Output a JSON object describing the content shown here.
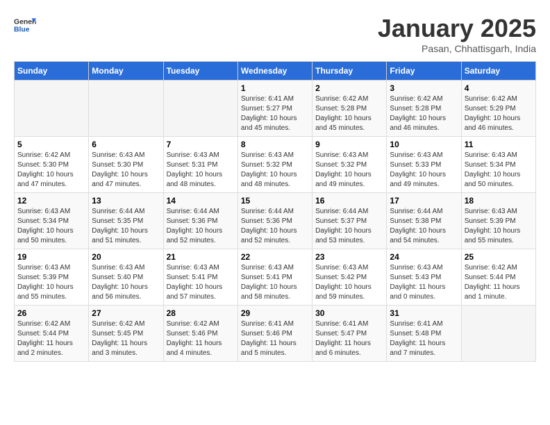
{
  "header": {
    "logo_general": "General",
    "logo_blue": "Blue",
    "month_year": "January 2025",
    "location": "Pasan, Chhattisgarh, India"
  },
  "days_of_week": [
    "Sunday",
    "Monday",
    "Tuesday",
    "Wednesday",
    "Thursday",
    "Friday",
    "Saturday"
  ],
  "weeks": [
    [
      {
        "day": "",
        "info": ""
      },
      {
        "day": "",
        "info": ""
      },
      {
        "day": "",
        "info": ""
      },
      {
        "day": "1",
        "info": "Sunrise: 6:41 AM\nSunset: 5:27 PM\nDaylight: 10 hours\nand 45 minutes."
      },
      {
        "day": "2",
        "info": "Sunrise: 6:42 AM\nSunset: 5:28 PM\nDaylight: 10 hours\nand 45 minutes."
      },
      {
        "day": "3",
        "info": "Sunrise: 6:42 AM\nSunset: 5:28 PM\nDaylight: 10 hours\nand 46 minutes."
      },
      {
        "day": "4",
        "info": "Sunrise: 6:42 AM\nSunset: 5:29 PM\nDaylight: 10 hours\nand 46 minutes."
      }
    ],
    [
      {
        "day": "5",
        "info": "Sunrise: 6:42 AM\nSunset: 5:30 PM\nDaylight: 10 hours\nand 47 minutes."
      },
      {
        "day": "6",
        "info": "Sunrise: 6:43 AM\nSunset: 5:30 PM\nDaylight: 10 hours\nand 47 minutes."
      },
      {
        "day": "7",
        "info": "Sunrise: 6:43 AM\nSunset: 5:31 PM\nDaylight: 10 hours\nand 48 minutes."
      },
      {
        "day": "8",
        "info": "Sunrise: 6:43 AM\nSunset: 5:32 PM\nDaylight: 10 hours\nand 48 minutes."
      },
      {
        "day": "9",
        "info": "Sunrise: 6:43 AM\nSunset: 5:32 PM\nDaylight: 10 hours\nand 49 minutes."
      },
      {
        "day": "10",
        "info": "Sunrise: 6:43 AM\nSunset: 5:33 PM\nDaylight: 10 hours\nand 49 minutes."
      },
      {
        "day": "11",
        "info": "Sunrise: 6:43 AM\nSunset: 5:34 PM\nDaylight: 10 hours\nand 50 minutes."
      }
    ],
    [
      {
        "day": "12",
        "info": "Sunrise: 6:43 AM\nSunset: 5:34 PM\nDaylight: 10 hours\nand 50 minutes."
      },
      {
        "day": "13",
        "info": "Sunrise: 6:44 AM\nSunset: 5:35 PM\nDaylight: 10 hours\nand 51 minutes."
      },
      {
        "day": "14",
        "info": "Sunrise: 6:44 AM\nSunset: 5:36 PM\nDaylight: 10 hours\nand 52 minutes."
      },
      {
        "day": "15",
        "info": "Sunrise: 6:44 AM\nSunset: 5:36 PM\nDaylight: 10 hours\nand 52 minutes."
      },
      {
        "day": "16",
        "info": "Sunrise: 6:44 AM\nSunset: 5:37 PM\nDaylight: 10 hours\nand 53 minutes."
      },
      {
        "day": "17",
        "info": "Sunrise: 6:44 AM\nSunset: 5:38 PM\nDaylight: 10 hours\nand 54 minutes."
      },
      {
        "day": "18",
        "info": "Sunrise: 6:43 AM\nSunset: 5:39 PM\nDaylight: 10 hours\nand 55 minutes."
      }
    ],
    [
      {
        "day": "19",
        "info": "Sunrise: 6:43 AM\nSunset: 5:39 PM\nDaylight: 10 hours\nand 55 minutes."
      },
      {
        "day": "20",
        "info": "Sunrise: 6:43 AM\nSunset: 5:40 PM\nDaylight: 10 hours\nand 56 minutes."
      },
      {
        "day": "21",
        "info": "Sunrise: 6:43 AM\nSunset: 5:41 PM\nDaylight: 10 hours\nand 57 minutes."
      },
      {
        "day": "22",
        "info": "Sunrise: 6:43 AM\nSunset: 5:41 PM\nDaylight: 10 hours\nand 58 minutes."
      },
      {
        "day": "23",
        "info": "Sunrise: 6:43 AM\nSunset: 5:42 PM\nDaylight: 10 hours\nand 59 minutes."
      },
      {
        "day": "24",
        "info": "Sunrise: 6:43 AM\nSunset: 5:43 PM\nDaylight: 11 hours\nand 0 minutes."
      },
      {
        "day": "25",
        "info": "Sunrise: 6:42 AM\nSunset: 5:44 PM\nDaylight: 11 hours\nand 1 minute."
      }
    ],
    [
      {
        "day": "26",
        "info": "Sunrise: 6:42 AM\nSunset: 5:44 PM\nDaylight: 11 hours\nand 2 minutes."
      },
      {
        "day": "27",
        "info": "Sunrise: 6:42 AM\nSunset: 5:45 PM\nDaylight: 11 hours\nand 3 minutes."
      },
      {
        "day": "28",
        "info": "Sunrise: 6:42 AM\nSunset: 5:46 PM\nDaylight: 11 hours\nand 4 minutes."
      },
      {
        "day": "29",
        "info": "Sunrise: 6:41 AM\nSunset: 5:46 PM\nDaylight: 11 hours\nand 5 minutes."
      },
      {
        "day": "30",
        "info": "Sunrise: 6:41 AM\nSunset: 5:47 PM\nDaylight: 11 hours\nand 6 minutes."
      },
      {
        "day": "31",
        "info": "Sunrise: 6:41 AM\nSunset: 5:48 PM\nDaylight: 11 hours\nand 7 minutes."
      },
      {
        "day": "",
        "info": ""
      }
    ]
  ]
}
